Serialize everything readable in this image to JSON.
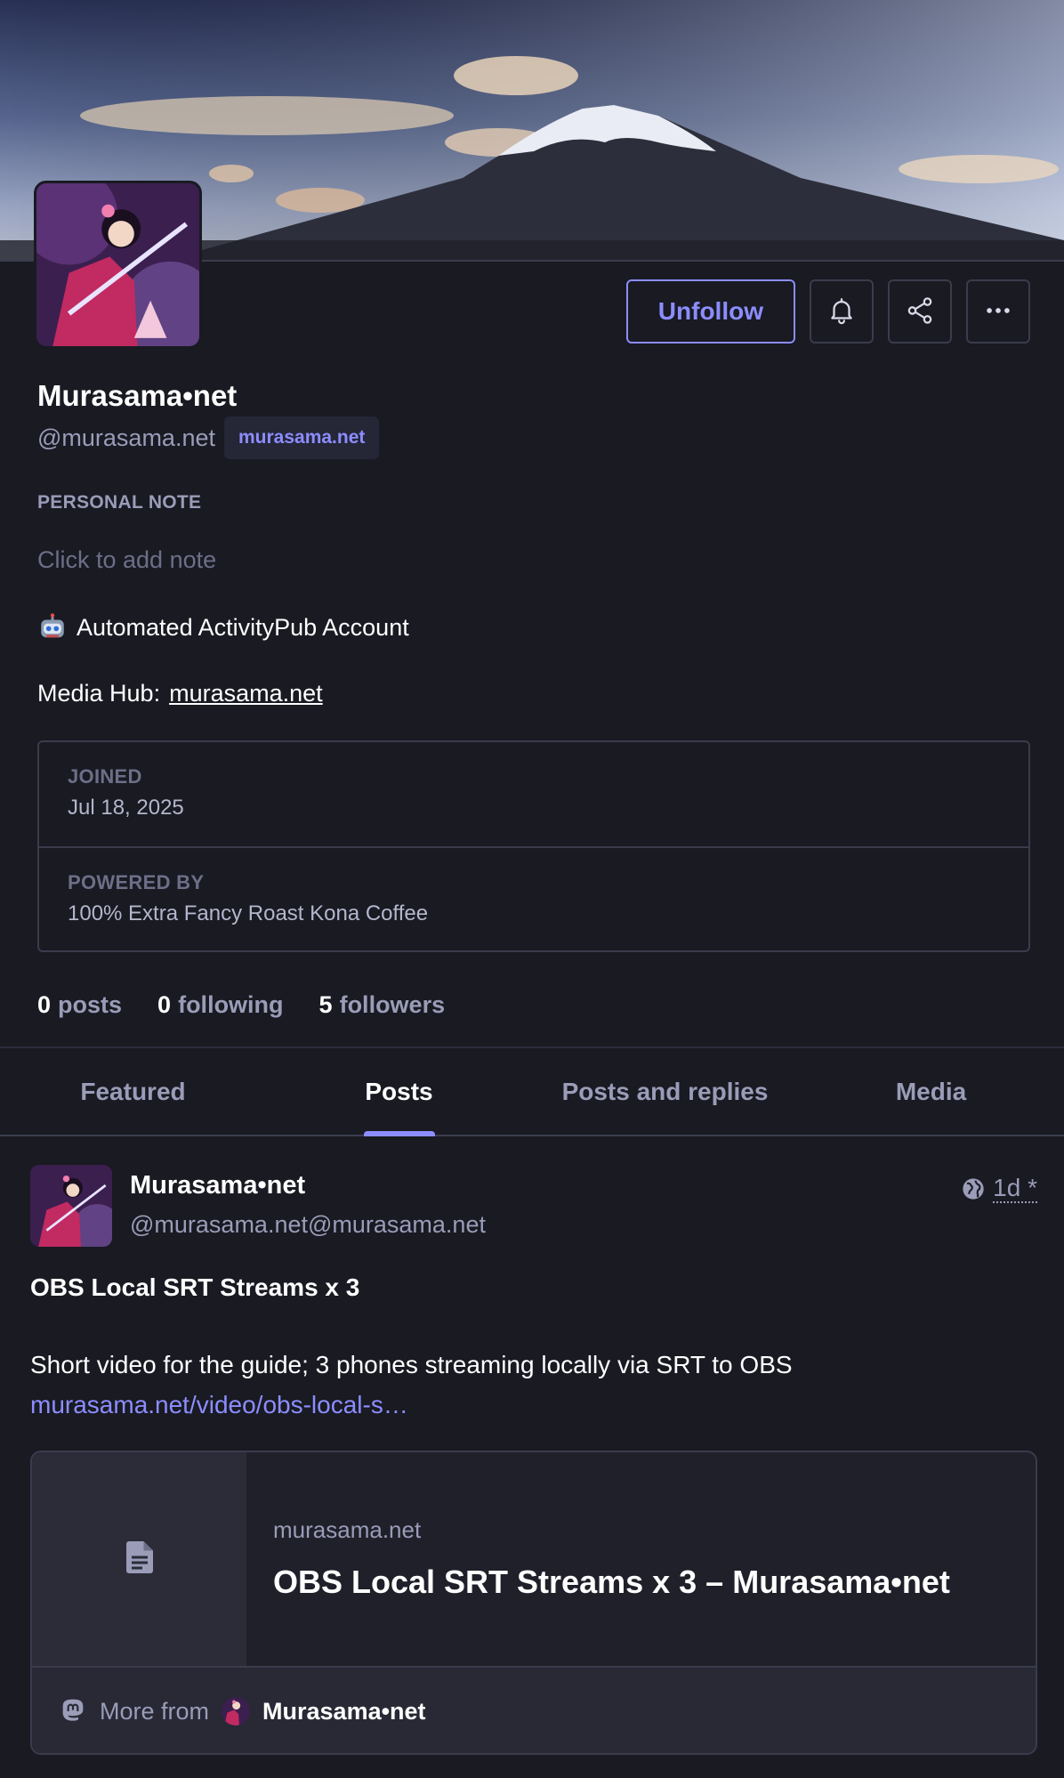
{
  "profile": {
    "display_name": "Murasama•net",
    "handle": "@murasama.net",
    "domain_badge": "murasama.net",
    "personal_note_label": "PERSONAL NOTE",
    "personal_note_placeholder": "Click to add note",
    "bio_line1": "Automated ActivityPub Account",
    "bio_line2_prefix": "Media Hub:",
    "bio_link": "murasama.net",
    "fields": [
      {
        "label": "JOINED",
        "value": "Jul 18, 2025"
      },
      {
        "label": "POWERED BY",
        "value": "100% Extra Fancy Roast Kona Coffee"
      }
    ],
    "counts": {
      "posts_num": "0",
      "posts_label": "posts",
      "following_num": "0",
      "following_label": "following",
      "followers_num": "5",
      "followers_label": "followers"
    }
  },
  "actions": {
    "unfollow_label": "Unfollow",
    "notify_icon": "bell-icon",
    "share_icon": "share-icon",
    "more_icon": "more-horizontal-icon"
  },
  "tabs": [
    {
      "label": "Featured",
      "active": false
    },
    {
      "label": "Posts",
      "active": true
    },
    {
      "label": "Posts and replies",
      "active": false
    },
    {
      "label": "Media",
      "active": false
    }
  ],
  "post": {
    "author_name": "Murasama•net",
    "author_handle": "@murasama.net@murasama.net",
    "visibility_icon": "globe-icon",
    "time": "1d",
    "time_marker": "*",
    "title": "OBS Local SRT Streams x 3",
    "body": "Short video for the guide; 3 phones streaming locally via SRT to OBS",
    "link": "murasama.net/video/obs-local-s…",
    "card": {
      "site": "murasama.net",
      "title": "OBS Local SRT Streams x 3 – Murasama•net",
      "more_from_label": "More from",
      "more_from_author": "Murasama•net"
    }
  },
  "colors": {
    "background": "#191a22",
    "accent": "#8c8dff",
    "border": "#3a3c4d",
    "muted_text": "#9a9cb8"
  }
}
